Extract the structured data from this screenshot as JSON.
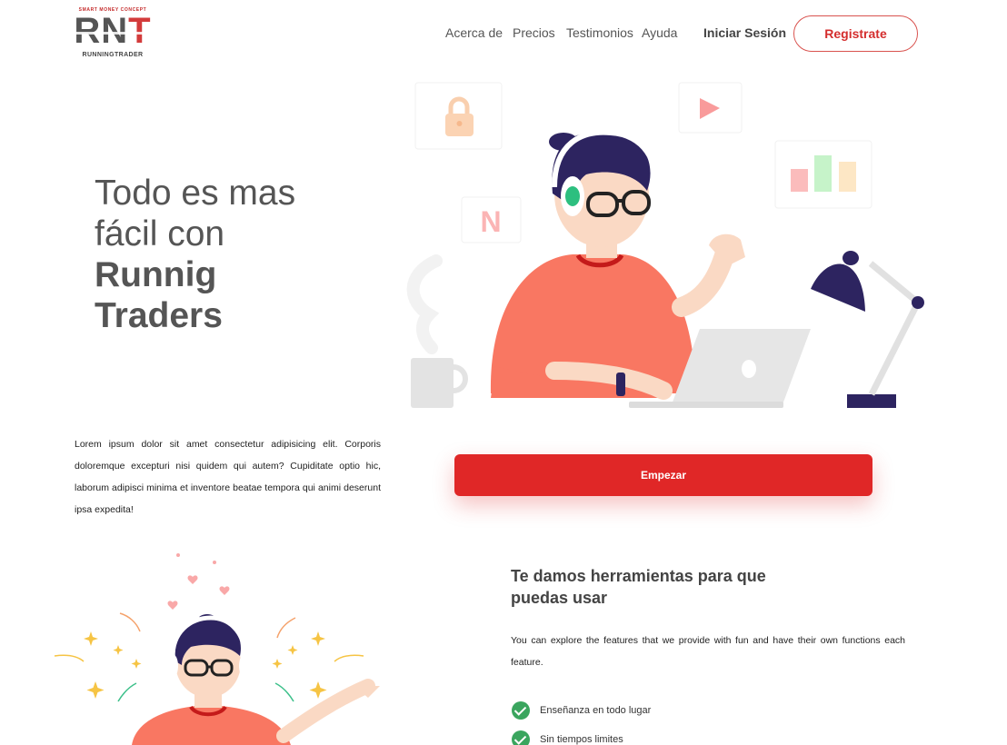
{
  "brand": {
    "tagline": "SMART MONEY CONCEPT",
    "mark_left": "RN",
    "mark_right": "T",
    "name": "RUNNINGTRADER"
  },
  "nav": {
    "items": [
      "Acerca de",
      "Precios",
      "Testimonios",
      "Ayuda"
    ],
    "login": "Iniciar Sesión",
    "register": "Registrate"
  },
  "hero": {
    "line1": "Todo es mas",
    "line2": "fácil con",
    "line3": "Runnig",
    "line4": "Traders",
    "body": "Lorem ipsum dolor sit amet consectetur adipisicing elit. Corporis doloremque excepturi nisi quidem qui autem? Cupiditate optio hic, laborum adipisci minima et inventore beatae tempora qui animi deserunt ipsa expedita!",
    "cta": "Empezar",
    "card_letter": "N"
  },
  "features": {
    "title": "Te damos herramientas para que puedas usar",
    "description": "You can explore the features that we provide with fun and have their own functions each feature.",
    "items": [
      "Enseñanza en todo lugar",
      "Sin tiempos limites"
    ]
  },
  "colors": {
    "accent": "#e02727",
    "check": "#3aa55e",
    "shirt": "#f97762",
    "hair": "#2d2460"
  },
  "icons": [
    "lock-icon",
    "play-icon",
    "bar-chart-icon",
    "checkmark-icon"
  ]
}
